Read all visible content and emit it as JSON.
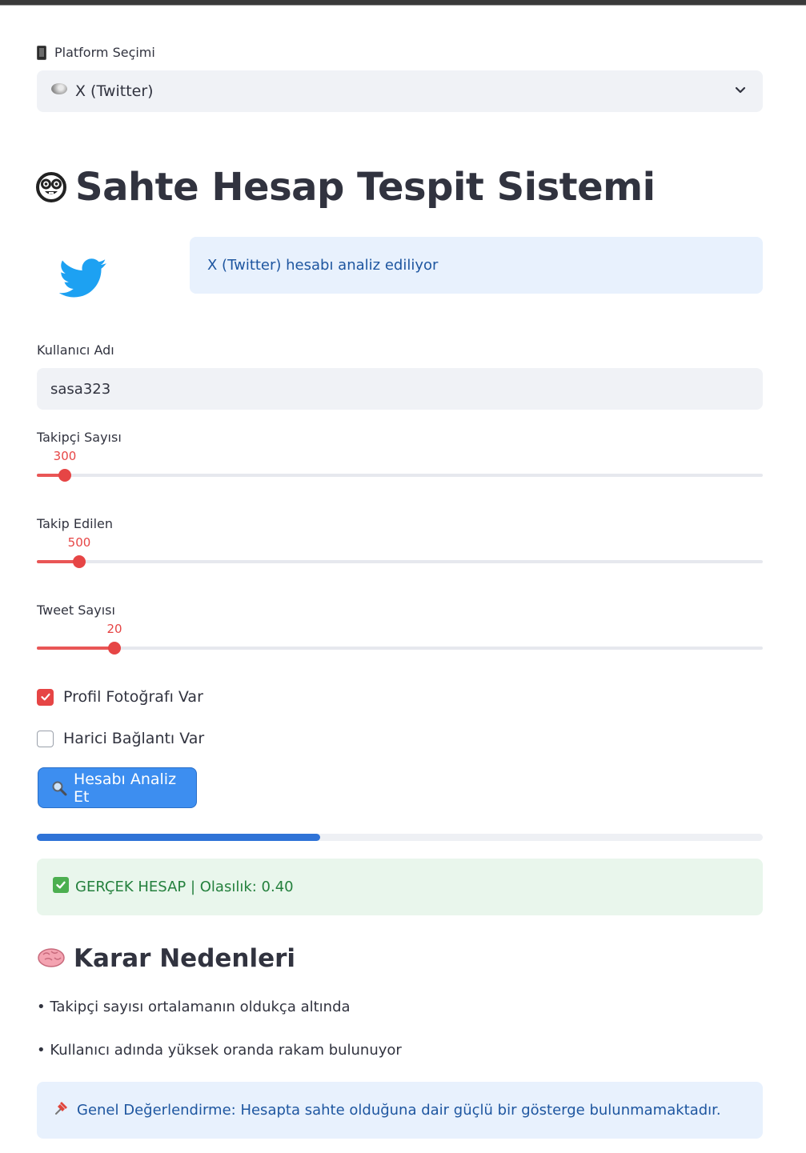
{
  "platform": {
    "label": "Platform Seçimi",
    "selected": "X (Twitter)",
    "icon": "phone-icon"
  },
  "title": "Sahte Hesap Tespit Sistemi",
  "info_text": "X (Twitter) hesabı analiz ediliyor",
  "username": {
    "label": "Kullanıcı Adı",
    "value": "sasa323"
  },
  "sliders": [
    {
      "label": "Takipçi Sayısı",
      "value": "300",
      "fraction": 0.038
    },
    {
      "label": "Takip Edilen",
      "value": "500",
      "fraction": 0.057
    },
    {
      "label": "Tweet Sayısı",
      "value": "20",
      "fraction": 0.107
    }
  ],
  "checkboxes": [
    {
      "label": "Profil Fotoğrafı Var",
      "checked": true
    },
    {
      "label": "Harici Bağlantı Var",
      "checked": false
    }
  ],
  "analyze_button": "Hesabı Analiz Et",
  "progress_fraction": 0.39,
  "result": "GERÇEK HESAP | Olasılık: 0.40",
  "reasons_title": "Karar Nedenleri",
  "reasons": [
    "• Takipçi sayısı ortalamanın oldukça altında",
    "• Kullanıcı adında yüksek oranda rakam bulunuyor"
  ],
  "overall": "Genel Değerlendirme: Hesapta sahte olduğuna dair güçlü bir gösterge bulunmamaktadır.",
  "colors": {
    "accent": "#e64545",
    "button": "#3d8ef0",
    "info_bg": "#e8f1fd",
    "success_bg": "#e9f6ec"
  }
}
